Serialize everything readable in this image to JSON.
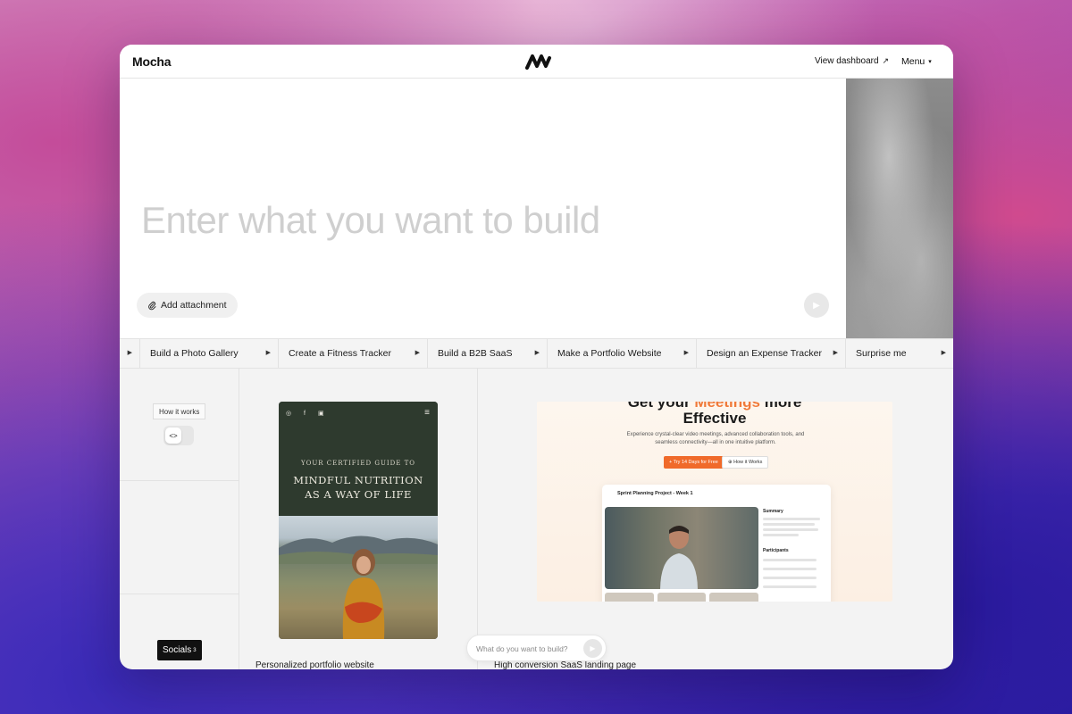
{
  "header": {
    "brand": "Mocha",
    "view_dashboard": "View dashboard",
    "view_dashboard_arrow": "↗",
    "menu": "Menu",
    "menu_caret": "▾"
  },
  "prompt": {
    "placeholder": "Enter what you want to build",
    "attach_label": "Add attachment"
  },
  "suggestions": [
    {
      "label": ""
    },
    {
      "label": "Build a Photo Gallery"
    },
    {
      "label": "Create a Fitness Tracker"
    },
    {
      "label": "Build a B2B SaaS"
    },
    {
      "label": "Make a Portfolio Website"
    },
    {
      "label": "Design an Expense Tracker"
    },
    {
      "label": "Surprise me"
    }
  ],
  "left": {
    "how_it_works": "How it works",
    "code_icon": "<>",
    "socials": "Socials",
    "socials_count": "3"
  },
  "portfolio": {
    "kicker": "YOUR CERTIFIED GUIDE TO",
    "title_line1": "MINDFUL NUTRITION",
    "title_line2": "AS A WAY OF LIFE",
    "caption": "Personalized portfolio website"
  },
  "saas": {
    "headline_pre": "Get your ",
    "headline_accent": "Meetings",
    "headline_post": " more",
    "headline_line2": "Effective",
    "sub": "Experience crystal-clear video meetings, advanced collaboration tools, and seamless connectivity—all in one intuitive platform.",
    "cta_primary": "+ Try 14 Days for Free",
    "cta_secondary": "⊕ How it Works",
    "card_title": "Sprint Planning Project - Week 1",
    "summary_label": "Summary",
    "participants_label": "Participants",
    "caption": "High conversion SaaS landing page"
  },
  "ask": {
    "placeholder": "What do you want to build?"
  },
  "colors": {
    "accent": "#f07a3a",
    "dark_green": "#2e3a2e"
  }
}
